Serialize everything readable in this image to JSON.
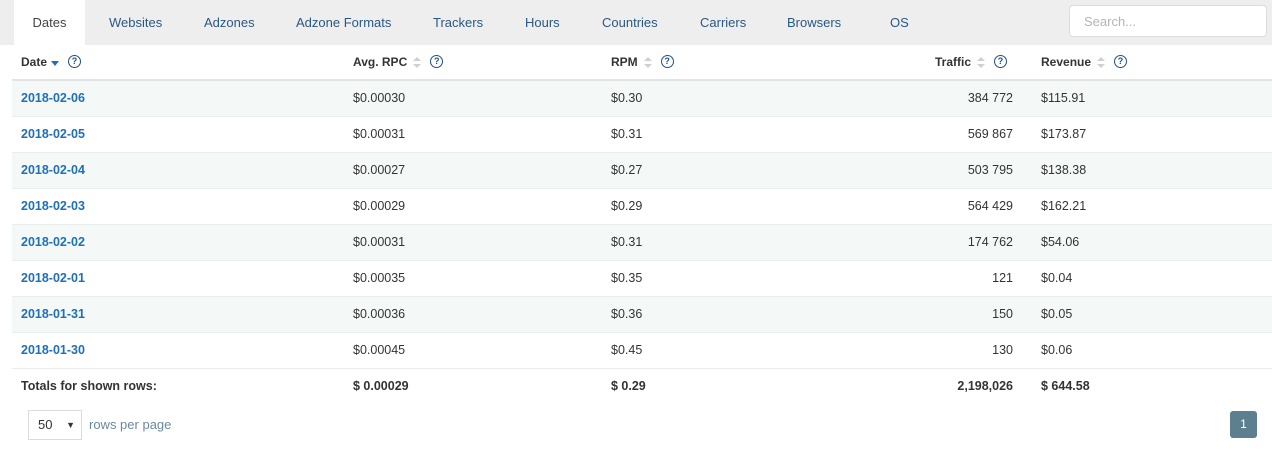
{
  "tabs": [
    "Dates",
    "Websites",
    "Adzones",
    "Adzone Formats",
    "Trackers",
    "Hours",
    "Countries",
    "Carriers",
    "Browsers",
    "OS"
  ],
  "search": {
    "placeholder": "Search..."
  },
  "columns": {
    "date": "Date",
    "avg_rpc": "Avg. RPC",
    "rpm": "RPM",
    "traffic": "Traffic",
    "revenue": "Revenue",
    "help_glyph": "?"
  },
  "rows": [
    {
      "date": "2018-02-06",
      "avg_rpc": "$0.00030",
      "rpm": "$0.30",
      "traffic": "384 772",
      "revenue": "$115.91"
    },
    {
      "date": "2018-02-05",
      "avg_rpc": "$0.00031",
      "rpm": "$0.31",
      "traffic": "569 867",
      "revenue": "$173.87"
    },
    {
      "date": "2018-02-04",
      "avg_rpc": "$0.00027",
      "rpm": "$0.27",
      "traffic": "503 795",
      "revenue": "$138.38"
    },
    {
      "date": "2018-02-03",
      "avg_rpc": "$0.00029",
      "rpm": "$0.29",
      "traffic": "564 429",
      "revenue": "$162.21"
    },
    {
      "date": "2018-02-02",
      "avg_rpc": "$0.00031",
      "rpm": "$0.31",
      "traffic": "174 762",
      "revenue": "$54.06"
    },
    {
      "date": "2018-02-01",
      "avg_rpc": "$0.00035",
      "rpm": "$0.35",
      "traffic": "121",
      "revenue": "$0.04"
    },
    {
      "date": "2018-01-31",
      "avg_rpc": "$0.00036",
      "rpm": "$0.36",
      "traffic": "150",
      "revenue": "$0.05"
    },
    {
      "date": "2018-01-30",
      "avg_rpc": "$0.00045",
      "rpm": "$0.45",
      "traffic": "130",
      "revenue": "$0.06"
    }
  ],
  "totals": {
    "label": "Totals for shown rows:",
    "avg_rpc": "$ 0.00029",
    "rpm": "$ 0.29",
    "traffic": "2,198,026",
    "revenue": "$ 644.58"
  },
  "pagination": {
    "rows_per_page_value": "50",
    "rows_per_page_label": "rows per page",
    "current_page": "1"
  },
  "colors": {
    "link": "#1f6fb8",
    "tab_bar": "#eeeeee",
    "row_alt": "#f4f9f7",
    "page_button": "#5e7f8f"
  }
}
